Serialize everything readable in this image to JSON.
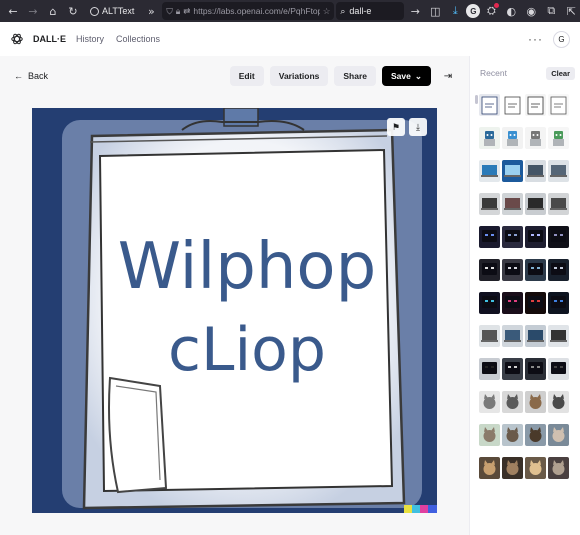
{
  "browser": {
    "tab_title": "ALTText",
    "url": "https://labs.openai.com/e/PqhFtop",
    "search_text": "dall-e",
    "profile_initial": "G",
    "icons": [
      "back-arrow-icon",
      "forward-arrow-icon",
      "home-icon",
      "reload-icon",
      "globe-icon",
      "chevron-double-right-icon",
      "shield-icon",
      "lock-icon",
      "swap-icon",
      "star-icon",
      "search-icon",
      "arrow-right-icon",
      "pocket-icon",
      "download-icon",
      "extension-icon",
      "puzzle-icon",
      "menu-icon"
    ]
  },
  "header": {
    "brand": "DALL·E",
    "nav": [
      "History",
      "Collections"
    ],
    "more": "···",
    "user_initial": "G"
  },
  "toolbar": {
    "back_label": "Back",
    "edit_label": "Edit",
    "variations_label": "Variations",
    "share_label": "Share",
    "save_label": "Save"
  },
  "image": {
    "line1": "Wilphop",
    "line2": "cLiop",
    "border_color": "#243e72",
    "paper_color": "#ffffff",
    "ink_color": "#3a5a8c"
  },
  "panel": {
    "recent_label": "Recent",
    "clear_label": "Clear",
    "thumbnails": [
      {
        "type": "paper",
        "bg": "#e6e8ee",
        "fg": "#2b3f6e"
      },
      {
        "type": "paper",
        "bg": "#ffffff",
        "fg": "#444444"
      },
      {
        "type": "paper",
        "bg": "#f4f4f4",
        "fg": "#333333"
      },
      {
        "type": "paper",
        "bg": "#f8f8f8",
        "fg": "#555555"
      },
      {
        "type": "robot",
        "bg": "#eef3ee",
        "fg": "#2a6a9a"
      },
      {
        "type": "robot",
        "bg": "#f2f2f2",
        "fg": "#3a8fd0"
      },
      {
        "type": "robot",
        "bg": "#f4f4f4",
        "fg": "#777777"
      },
      {
        "type": "robot",
        "bg": "#f6f6f6",
        "fg": "#4a9a5a"
      },
      {
        "type": "laptop",
        "bg": "#e3e8ec",
        "fg": "#2a7ab8"
      },
      {
        "type": "laptop",
        "bg": "#1c5a9c",
        "fg": "#9ad0f0"
      },
      {
        "type": "laptop",
        "bg": "#d8dde2",
        "fg": "#445566"
      },
      {
        "type": "laptop",
        "bg": "#dde2e6",
        "fg": "#556677"
      },
      {
        "type": "laptop",
        "bg": "#d4d6d8",
        "fg": "#3a3a3a"
      },
      {
        "type": "laptop",
        "bg": "#cfd3d6",
        "fg": "#6a4a4a"
      },
      {
        "type": "laptop",
        "bg": "#c8ccd0",
        "fg": "#2a2a2a"
      },
      {
        "type": "laptop",
        "bg": "#d2d4d6",
        "fg": "#4a4a4a"
      },
      {
        "type": "face",
        "bg": "#1a1a2e",
        "fg": "#6a8ef0"
      },
      {
        "type": "face",
        "bg": "#2a2a3e",
        "fg": "#8aa0d0"
      },
      {
        "type": "face",
        "bg": "#1e1e30",
        "fg": "#b0b8ff"
      },
      {
        "type": "face",
        "bg": "#101018",
        "fg": "#9090c0"
      },
      {
        "type": "face",
        "bg": "#202028",
        "fg": "#e0e0e0"
      },
      {
        "type": "face",
        "bg": "#3a3a44",
        "fg": "#d8d8e0"
      },
      {
        "type": "face",
        "bg": "#2c3a4a",
        "fg": "#7fb0d0"
      },
      {
        "type": "face",
        "bg": "#18202c",
        "fg": "#c0c8d8"
      },
      {
        "type": "face",
        "bg": "#101020",
        "fg": "#40c0e0"
      },
      {
        "type": "face",
        "bg": "#1a0e1a",
        "fg": "#e04080"
      },
      {
        "type": "face",
        "bg": "#140a0a",
        "fg": "#e04040"
      },
      {
        "type": "face",
        "bg": "#0e1420",
        "fg": "#4080e0"
      },
      {
        "type": "laptop",
        "bg": "#dfe3e6",
        "fg": "#555555"
      },
      {
        "type": "laptop",
        "bg": "#d0d6dc",
        "fg": "#3a5a7a"
      },
      {
        "type": "laptop",
        "bg": "#c4ccd4",
        "fg": "#2a4a6a"
      },
      {
        "type": "laptop",
        "bg": "#e0e4e8",
        "fg": "#333333"
      },
      {
        "type": "face",
        "bg": "#c8ccd2",
        "fg": "#222222"
      },
      {
        "type": "face",
        "bg": "#3a3f48",
        "fg": "#d0d0d0"
      },
      {
        "type": "face",
        "bg": "#2a2e36",
        "fg": "#8a8a8a"
      },
      {
        "type": "face",
        "bg": "#dde0e4",
        "fg": "#444444"
      },
      {
        "type": "cat",
        "bg": "#e6e6e6",
        "fg": "#7a7a7a"
      },
      {
        "type": "cat",
        "bg": "#d8d8d8",
        "fg": "#5a5a5a"
      },
      {
        "type": "cat",
        "bg": "#cfcfcf",
        "fg": "#8a6a4a"
      },
      {
        "type": "cat",
        "bg": "#e2e2e2",
        "fg": "#4a4a4a"
      },
      {
        "type": "cat",
        "bg": "#c8d8c8",
        "fg": "#8a7a6a"
      },
      {
        "type": "cat",
        "bg": "#b8c4cc",
        "fg": "#6a5a4a"
      },
      {
        "type": "cat",
        "bg": "#8a9aa8",
        "fg": "#4a3a2a"
      },
      {
        "type": "cat",
        "bg": "#7a8a98",
        "fg": "#d0c0b0"
      },
      {
        "type": "cat",
        "bg": "#5a4a3a",
        "fg": "#c8a070"
      },
      {
        "type": "cat",
        "bg": "#3a3028",
        "fg": "#a08060"
      },
      {
        "type": "cat",
        "bg": "#6a5a48",
        "fg": "#e0c090"
      },
      {
        "type": "cat",
        "bg": "#4a4040",
        "fg": "#b0a090"
      }
    ]
  }
}
